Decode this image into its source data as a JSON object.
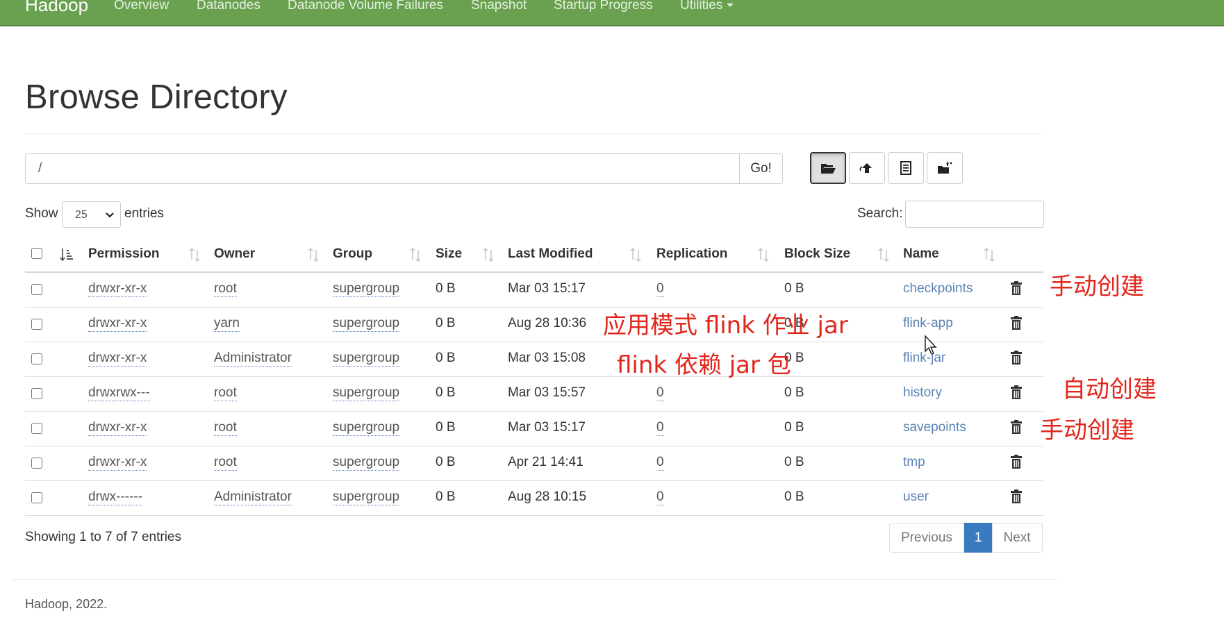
{
  "navbar": {
    "brand": "Hadoop",
    "items": [
      "Overview",
      "Datanodes",
      "Datanode Volume Failures",
      "Snapshot",
      "Startup Progress",
      "Utilities"
    ]
  },
  "page": {
    "title": "Browse Directory"
  },
  "path_bar": {
    "value": "/",
    "go_label": "Go!"
  },
  "toolbar": {
    "icons": [
      "folder-open-icon",
      "cloud-upload-icon",
      "list-alt-icon",
      "paste-icon"
    ]
  },
  "table_controls": {
    "show_label": "Show",
    "entries_value": "25",
    "entries_label": "entries",
    "search_label": "Search:"
  },
  "table": {
    "columns": [
      "Permission",
      "Owner",
      "Group",
      "Size",
      "Last Modified",
      "Replication",
      "Block Size",
      "Name"
    ],
    "rows": [
      {
        "permission": "drwxr-xr-x",
        "owner": "root",
        "group": "supergroup",
        "size": "0 B",
        "modified": "Mar 03 15:17",
        "replication": "0",
        "block_size": "0 B",
        "name": "checkpoints"
      },
      {
        "permission": "drwxr-xr-x",
        "owner": "yarn",
        "group": "supergroup",
        "size": "0 B",
        "modified": "Aug 28 10:36",
        "replication": "",
        "block_size": "0 B",
        "name": "flink-app"
      },
      {
        "permission": "drwxr-xr-x",
        "owner": "Administrator",
        "group": "supergroup",
        "size": "0 B",
        "modified": "Mar 03 15:08",
        "replication": "",
        "block_size": "0 B",
        "name": "flink-jar"
      },
      {
        "permission": "drwxrwx---",
        "owner": "root",
        "group": "supergroup",
        "size": "0 B",
        "modified": "Mar 03 15:57",
        "replication": "0",
        "block_size": "0 B",
        "name": "history"
      },
      {
        "permission": "drwxr-xr-x",
        "owner": "root",
        "group": "supergroup",
        "size": "0 B",
        "modified": "Mar 03 15:17",
        "replication": "0",
        "block_size": "0 B",
        "name": "savepoints"
      },
      {
        "permission": "drwxr-xr-x",
        "owner": "root",
        "group": "supergroup",
        "size": "0 B",
        "modified": "Apr 21 14:41",
        "replication": "0",
        "block_size": "0 B",
        "name": "tmp"
      },
      {
        "permission": "drwx------",
        "owner": "Administrator",
        "group": "supergroup",
        "size": "0 B",
        "modified": "Aug 28 10:15",
        "replication": "0",
        "block_size": "0 B",
        "name": "user"
      }
    ]
  },
  "footer": {
    "info": "Showing 1 to 7 of 7 entries",
    "previous": "Previous",
    "current_page": "1",
    "next": "Next",
    "copyright": "Hadoop, 2022."
  },
  "annotations": {
    "checkpoints": "手动创建",
    "flink_app": "应用模式 flink 作业 jar",
    "flink_jar": "flink 依赖 jar 包",
    "history": "自动创建",
    "savepoints": "手动创建"
  },
  "colors": {
    "navbar": "#6aa150",
    "link": "#5a83b3",
    "pager_active": "#3a7ac0",
    "annotation": "#e3261b"
  }
}
